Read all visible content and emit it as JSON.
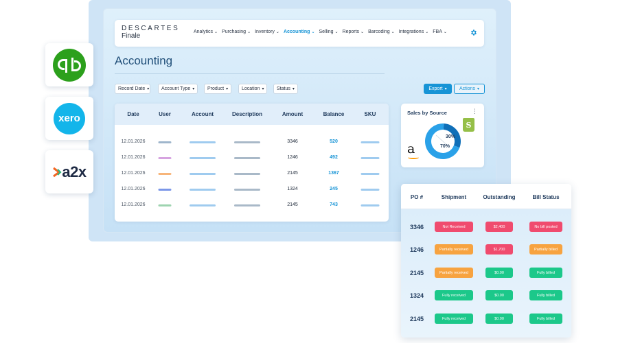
{
  "integrations": [
    {
      "name": "quickbooks",
      "glyph": "qb",
      "color": "#2ca01c"
    },
    {
      "name": "xero",
      "label": "xero",
      "color": "#13b5ea"
    },
    {
      "name": "a2x",
      "label": "a2x"
    }
  ],
  "brand": {
    "line1": "DESCARTES",
    "line2": "Finale"
  },
  "nav": [
    {
      "label": "Analytics",
      "active": false
    },
    {
      "label": "Purchasing",
      "active": false
    },
    {
      "label": "Inventory",
      "active": false
    },
    {
      "label": "Accounting",
      "active": true
    },
    {
      "label": "Selling",
      "active": false
    },
    {
      "label": "Reports",
      "active": false
    },
    {
      "label": "Barcoding",
      "active": false
    },
    {
      "label": "Integrations",
      "active": false
    },
    {
      "label": "FBA",
      "active": false
    }
  ],
  "page": {
    "title": "Accounting"
  },
  "filters": [
    "Record Date",
    "Account Type",
    "Product",
    "Location",
    "Status"
  ],
  "buttons": {
    "export": "Export",
    "actions": "Actions"
  },
  "accounting_table": {
    "headers": [
      "Date",
      "User",
      "Account",
      "Description",
      "Amount",
      "Balance",
      "SKU"
    ],
    "rows": [
      {
        "date": "12.01.2026",
        "user_color": "#9fb6cc",
        "amount": "3346",
        "balance": "520"
      },
      {
        "date": "12.01.2026",
        "user_color": "#d6a3e0",
        "amount": "1246",
        "balance": "492"
      },
      {
        "date": "12.01.2026",
        "user_color": "#f7b57a",
        "amount": "2145",
        "balance": "1367"
      },
      {
        "date": "12.01.2026",
        "user_color": "#7b97e8",
        "amount": "1324",
        "balance": "245"
      },
      {
        "date": "12.01.2026",
        "user_color": "#9ed4b0",
        "amount": "2145",
        "balance": "743"
      }
    ]
  },
  "sales_widget": {
    "title": "Sales by Source",
    "menu_icon": "more-vertical-icon",
    "amazon_glyph": "a",
    "shopify_glyph": "S",
    "slices": [
      {
        "source": "shopify",
        "percent": 30,
        "label": "30%",
        "color": "#0f6fb8"
      },
      {
        "source": "amazon",
        "percent": 70,
        "label": "70%",
        "color": "#2aa1e8"
      }
    ]
  },
  "po_table": {
    "headers": [
      "PO #",
      "Shipment",
      "Outstanding",
      "Bill Status"
    ],
    "rows": [
      {
        "po": "3346",
        "shipment": "Not Received",
        "shipment_color": "#f04b6e",
        "outstanding": "$2,400",
        "outstanding_color": "#f04b6e",
        "bill": "No bill posted",
        "bill_color": "#f04b6e"
      },
      {
        "po": "1246",
        "shipment": "Partially received",
        "shipment_color": "#f7a340",
        "outstanding": "$1,700",
        "outstanding_color": "#f04b6e",
        "bill": "Partially billed",
        "bill_color": "#f7a340"
      },
      {
        "po": "2145",
        "shipment": "Partially received",
        "shipment_color": "#f7a340",
        "outstanding": "$0.00",
        "outstanding_color": "#1cc88a",
        "bill": "Fully billed",
        "bill_color": "#1cc88a"
      },
      {
        "po": "1324",
        "shipment": "Fully received",
        "shipment_color": "#1cc88a",
        "outstanding": "$0.00",
        "outstanding_color": "#1cc88a",
        "bill": "Fully billed",
        "bill_color": "#1cc88a"
      },
      {
        "po": "2145",
        "shipment": "Fully received",
        "shipment_color": "#1cc88a",
        "outstanding": "$0.00",
        "outstanding_color": "#1cc88a",
        "bill": "Fully billed",
        "bill_color": "#1cc88a"
      }
    ]
  }
}
